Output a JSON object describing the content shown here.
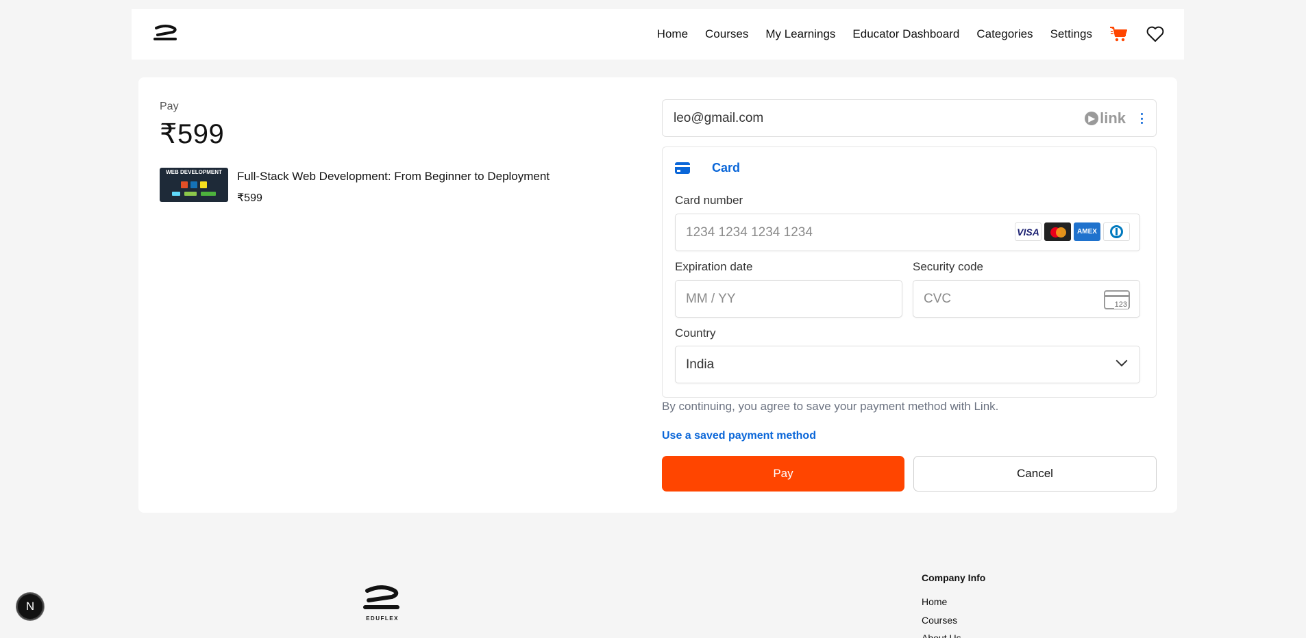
{
  "header": {
    "nav": [
      "Home",
      "Courses",
      "My Learnings",
      "Educator Dashboard",
      "Categories",
      "Settings"
    ],
    "cart_icon": "cart-icon",
    "wishlist_icon": "heart-icon",
    "accent": "#ff4500"
  },
  "summary": {
    "pay_label": "Pay",
    "amount": "₹599",
    "course": {
      "title": "Full-Stack Web Development: From Beginner to Deployment",
      "price": "₹599",
      "thumb_text": "WEB DEVELOPMENT"
    }
  },
  "payment": {
    "email": "leo@gmail.com",
    "link_brand": "link",
    "method_tab": "Card",
    "card_number_label": "Card number",
    "card_number_placeholder": "1234 1234 1234 1234",
    "brands": [
      "VISA",
      "Mastercard",
      "AMEX",
      "Diners"
    ],
    "expiry_label": "Expiration date",
    "expiry_placeholder": "MM / YY",
    "cvc_label": "Security code",
    "cvc_placeholder": "CVC",
    "cvc_icon_text": "123",
    "country_label": "Country",
    "country_value": "India",
    "consent": "By continuing, you agree to save your payment method with Link.",
    "saved_method_link": "Use a saved payment method",
    "link_color": "#0a66d8"
  },
  "actions": {
    "pay": "Pay",
    "cancel": "Cancel"
  },
  "footer": {
    "brand_name": "EDUFLEX",
    "company_heading": "Company Info",
    "links": [
      "Home",
      "Courses",
      "About Us"
    ]
  },
  "dev_badge": "N"
}
